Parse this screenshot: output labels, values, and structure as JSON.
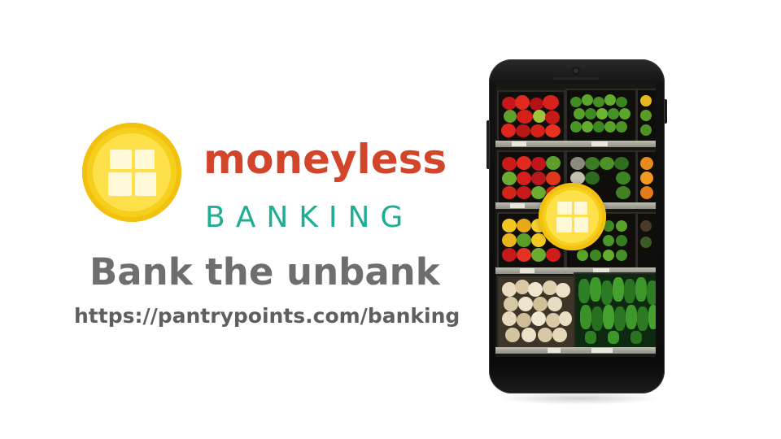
{
  "brand": {
    "word": "moneyless",
    "sub": "BANKING",
    "primary_color": "#d2452b",
    "secondary_color": "#1fae94",
    "coin_color": "#f6cf1d",
    "logo_icon": "coin-grid-icon"
  },
  "tagline": "Bank the unbank",
  "url": "https://pantrypoints.com/banking",
  "phone": {
    "screen_image": "grocery-produce-shelves",
    "overlay_icon": "coin-grid-icon"
  }
}
